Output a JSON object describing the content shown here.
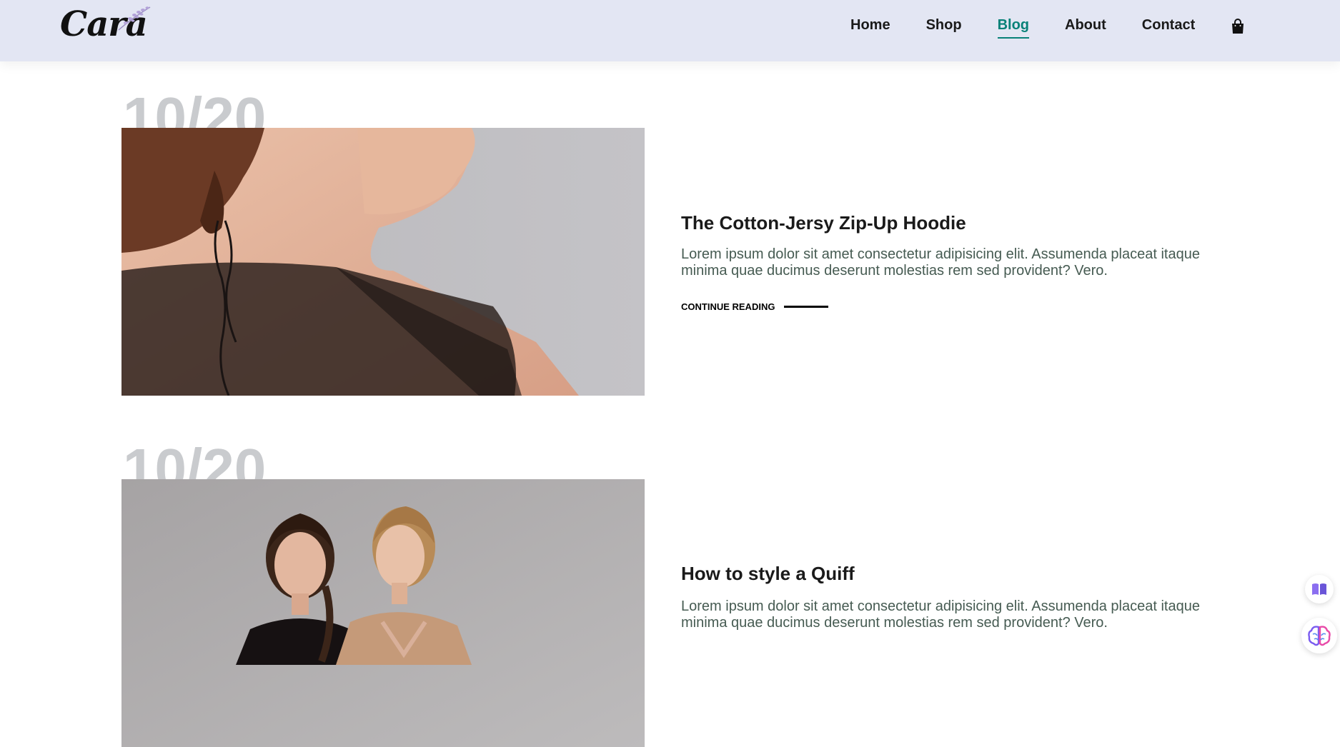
{
  "brand": {
    "logo_text": "Cara",
    "logo_alt": "Cara logo"
  },
  "nav": {
    "items": [
      {
        "label": "Home"
      },
      {
        "label": "Shop"
      },
      {
        "label": "Blog"
      },
      {
        "label": "About"
      },
      {
        "label": "Contact"
      }
    ],
    "active": "Blog",
    "cart_icon": "shopping-bag-icon"
  },
  "posts": [
    {
      "date": "10/20",
      "title": "The Cotton-Jersy Zip-Up Hoodie",
      "excerpt": "Lorem ipsum dolor sit amet consectetur adipisicing elit. Assumenda placeat itaque minima quae ducimus deserunt molestias rem sed provident? Vero.",
      "link_label": "CONTINUE READING"
    },
    {
      "date": "10/20",
      "title": "How to style a Quiff",
      "excerpt": "Lorem ipsum dolor sit amet consectetur adipisicing elit. Assumenda placeat itaque minima quae ducimus deserunt molestias rem sed provident? Vero."
    }
  ],
  "widgets": {
    "reader_icon": "book-icon",
    "assistant_icon": "brain-icon"
  },
  "colors": {
    "header_bg": "#e3e6f3",
    "accent": "#088178",
    "date_gray": "#c9cbce",
    "excerpt": "#465b52"
  }
}
